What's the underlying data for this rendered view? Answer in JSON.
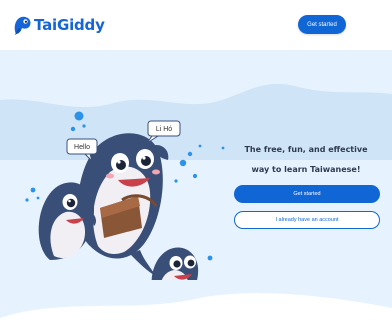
{
  "header": {
    "brand": "TaiGiddy",
    "cta_label": "Get started"
  },
  "hero": {
    "tagline_line1": "The free, fun, and effective",
    "tagline_line2": "way to learn Taiwanese!",
    "primary_button": "Get started",
    "secondary_button": "I already have an account"
  },
  "illustration": {
    "bubble_left": "Hello",
    "bubble_right": "Li Hó"
  },
  "colors": {
    "brand_blue": "#1166d6",
    "hero_background": "#e6f3ff",
    "tagline_text": "#2f3b52"
  }
}
